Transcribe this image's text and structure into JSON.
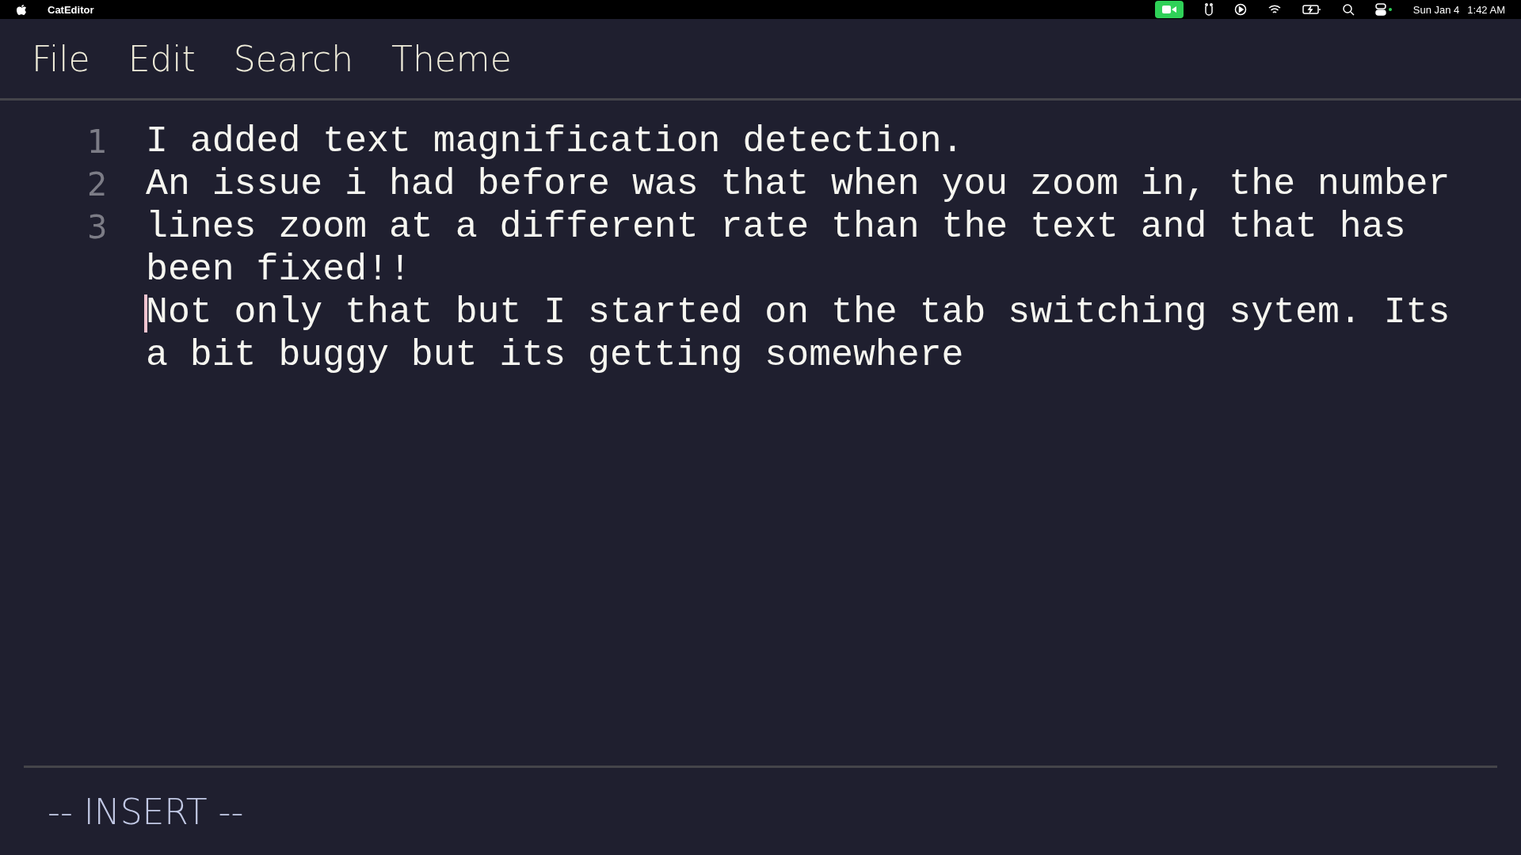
{
  "system_bar": {
    "app_name": "CatEditor",
    "date": "Sun Jan 4",
    "time": "1:42 AM"
  },
  "menu": [
    {
      "label": "File"
    },
    {
      "label": "Edit"
    },
    {
      "label": "Search"
    },
    {
      "label": "Theme"
    }
  ],
  "editor": {
    "lines": [
      {
        "number": "1",
        "text": "I added text magnification detection.",
        "cursor": false
      },
      {
        "number": "2",
        "text": "An issue i had before was that when you zoom in, the number lines zoom at a different rate than the text and that has been fixed!!",
        "cursor": false
      },
      {
        "number": "3",
        "text": "Not only that but I started on the tab switching sytem. Its a bit buggy but its getting somewhere",
        "cursor": true
      }
    ]
  },
  "status_bar": {
    "mode": "-- INSERT --"
  }
}
